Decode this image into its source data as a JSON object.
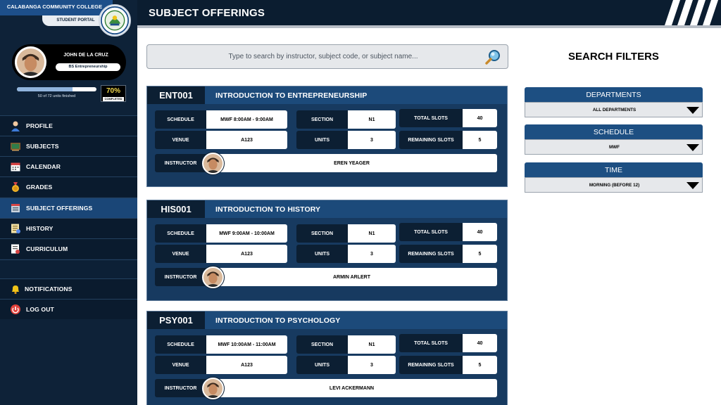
{
  "sidebar": {
    "school_name": "CALABANGA COMMUNITY COLLEGE",
    "portal_label": "STUDENT PORTAL",
    "student": {
      "name": "JOHN DE LA CRUZ",
      "program": "BS Entrepreneurship"
    },
    "progress": {
      "fraction": 0.7,
      "units_text": "50 of 72 units finished",
      "percent_text": "70%",
      "completed_label": "COMPLETED"
    },
    "nav": [
      {
        "label": "PROFILE",
        "icon": "profile-icon"
      },
      {
        "label": "SUBJECTS",
        "icon": "chalkboard-icon"
      },
      {
        "label": "CALENDAR",
        "icon": "calendar-icon"
      },
      {
        "label": "GRADES",
        "icon": "medal-icon"
      },
      {
        "label": "SUBJECT OFFERINGS",
        "icon": "offerings-icon",
        "active": true
      },
      {
        "label": "HISTORY",
        "icon": "history-icon"
      },
      {
        "label": "CURRICULUM",
        "icon": "curriculum-icon"
      }
    ],
    "footer_nav": [
      {
        "label": "NOTIFICATIONS",
        "icon": "bell-icon"
      },
      {
        "label": "LOG OUT",
        "icon": "logout-icon"
      }
    ]
  },
  "header": {
    "title": "SUBJECT OFFERINGS"
  },
  "search": {
    "placeholder": "Type to search by instructor, subject code, or subject name...",
    "icon": "search-icon"
  },
  "labels": {
    "schedule": "SCHEDULE",
    "venue": "VENUE",
    "section": "SECTION",
    "units": "UNITS",
    "total_slots": "TOTAL SLOTS",
    "remaining_slots": "REMAINING SLOTS",
    "instructor": "INSTRUCTOR"
  },
  "courses": [
    {
      "code": "ENT001",
      "name": "INTRODUCTION TO ENTREPRENEURSHIP",
      "schedule": "MWF 8:00AM - 9:00AM",
      "venue": "A123",
      "section": "N1",
      "units": "3",
      "total_slots": "40",
      "remaining_slots": "5",
      "instructor": "EREN YEAGER"
    },
    {
      "code": "HIS001",
      "name": "INTRODUCTION TO HISTORY",
      "schedule": "MWF 9:00AM - 10:00AM",
      "venue": "A123",
      "section": "N1",
      "units": "3",
      "total_slots": "40",
      "remaining_slots": "5",
      "instructor": "ARMIN ARLERT"
    },
    {
      "code": "PSY001",
      "name": "INTRODUCTION TO PSYCHOLOGY",
      "schedule": "MWF 10:00AM - 11:00AM",
      "venue": "A123",
      "section": "N1",
      "units": "3",
      "total_slots": "40",
      "remaining_slots": "5",
      "instructor": "LEVI ACKERMANN"
    }
  ],
  "filters": {
    "title": "SEARCH FILTERS",
    "items": [
      {
        "label": "DEPARTMENTS",
        "value": "ALL DEPARTMENTS"
      },
      {
        "label": "SCHEDULE",
        "value": "MWF"
      },
      {
        "label": "TIME",
        "value": "MORNING (BEFORE 12)"
      }
    ]
  },
  "colors": {
    "navy": "#0e2238",
    "header": "#0b1d30",
    "card": "#173a60",
    "accent": "#1d4f82",
    "progress_text": "#f2d94d"
  }
}
